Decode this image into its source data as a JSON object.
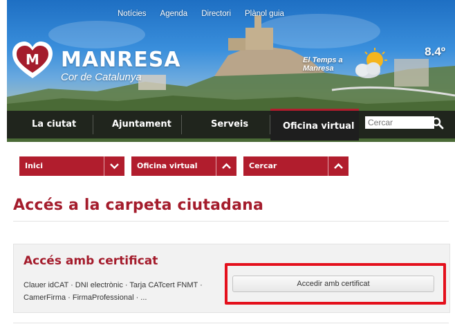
{
  "header": {
    "top_links": [
      "Notícies",
      "Agenda",
      "Directori",
      "Plànol guia"
    ],
    "logo": {
      "title": "MANRESA",
      "subtitle": "Cor de Catalunya"
    },
    "weather": {
      "label": "El Temps a Manresa",
      "temperature": "8.4º",
      "icon": "partly-cloudy-icon"
    }
  },
  "main_nav": {
    "items": [
      "La ciutat",
      "Ajuntament",
      "Serveis",
      "Oficina virtual"
    ],
    "active": "Oficina virtual",
    "search": {
      "placeholder": "Cercar",
      "value": "",
      "icon": "search-icon"
    }
  },
  "breadcrumb": [
    {
      "label": "Inici",
      "toggle": "chevron-down"
    },
    {
      "label": "Oficina virtual",
      "toggle": "chevron-up"
    },
    {
      "label": "Cercar",
      "toggle": "chevron-up"
    }
  ],
  "page": {
    "title": "Accés a la carpeta ciutadana",
    "panel": {
      "title": "Accés amb certificat",
      "description": "Clauer idCAT · DNI electrònic · Tarja CATcert FNMT · CamerFirma · FirmaProfessional · ...",
      "button_label": "Accedir amb certificat"
    }
  },
  "colors": {
    "accent": "#a41c2c",
    "breadcrumb_bg": "#b11d2d",
    "highlight": "#e4101c",
    "nav_bg": "#1e1e1e"
  }
}
